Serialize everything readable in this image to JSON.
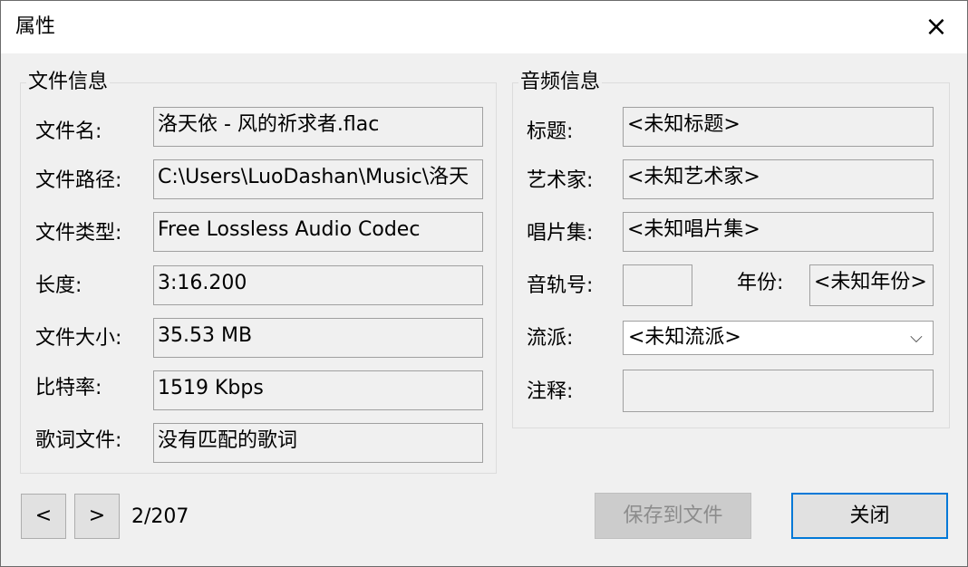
{
  "window": {
    "title": "属性",
    "close_icon": "×"
  },
  "file_info": {
    "group_title": "文件信息",
    "rows": [
      {
        "label": "文件名:",
        "value": "洛天依 - 风的祈求者.flac"
      },
      {
        "label": "文件路径:",
        "value": "C:\\Users\\LuoDashan\\Music\\洛天"
      },
      {
        "label": "文件类型:",
        "value": "Free Lossless Audio Codec"
      },
      {
        "label": "长度:",
        "value": "3:16.200"
      },
      {
        "label": "文件大小:",
        "value": "35.53 MB"
      },
      {
        "label": "比特率:",
        "value": "1519 Kbps"
      },
      {
        "label": "歌词文件:",
        "value": "没有匹配的歌词"
      }
    ]
  },
  "audio_info": {
    "group_title": "音频信息",
    "title_label": "标题:",
    "title_value": "<未知标题>",
    "artist_label": "艺术家:",
    "artist_value": "<未知艺术家>",
    "album_label": "唱片集:",
    "album_value": "<未知唱片集>",
    "track_label": "音轨号:",
    "track_value": "",
    "year_label": "年份:",
    "year_value": "<未知年份>",
    "genre_label": "流派:",
    "genre_value": "<未知流派>",
    "genre_arrow_icon": "chevron-down-icon",
    "comment_label": "注释:",
    "comment_value": ""
  },
  "footer": {
    "prev_label": "<",
    "next_label": ">",
    "page_indicator": "2/207",
    "save_label": "保存到文件",
    "close_label": "关闭"
  }
}
